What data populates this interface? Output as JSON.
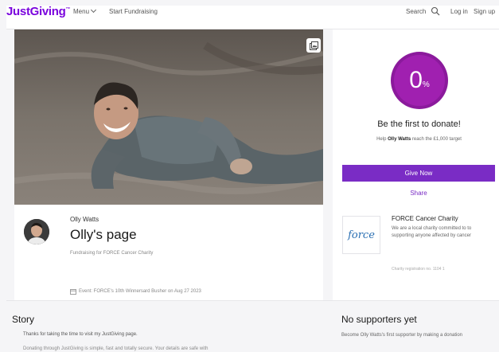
{
  "header": {
    "logo": "JustGiving",
    "logo_mark": "™",
    "menu_label": "Menu",
    "start_label": "Start Fundraising",
    "search_label": "Search",
    "login_label": "Log in",
    "signup_label": "Sign up"
  },
  "donate": {
    "percent": "0",
    "percent_sign": "%",
    "headline": "Be the first to donate!",
    "help_prefix": "Help",
    "help_name": "Olly Watts",
    "help_suffix": "reach the £1,000 target",
    "give_label": "Give Now",
    "share_label": "Share"
  },
  "profile": {
    "owner": "Olly Watts",
    "title": "Olly's page",
    "fundraising_for": "Fundraising for FORCE Cancer Charity",
    "event": "Event: FORCE's 10th Winnersard Busher on Aug 27 2023"
  },
  "charity": {
    "logo_text": "force",
    "name": "FORCE Cancer Charity",
    "description": "We are a local charity committed to to supporting anyone affected by cancer",
    "registration": "Charity registration no. 1104 1"
  },
  "story": {
    "heading": "Story",
    "line1": "Thanks for taking the time to visit my JustGiving page.",
    "line2": "Donating through JustGiving is simple, fast and totally secure. Your details are safe with"
  },
  "supporters": {
    "heading": "No supporters yet",
    "text": "Become Olly Watts's first supporter by making a donation"
  },
  "colors": {
    "brand": "#7a04dd",
    "button": "#7a2cc5",
    "ring": "#a020b0"
  }
}
